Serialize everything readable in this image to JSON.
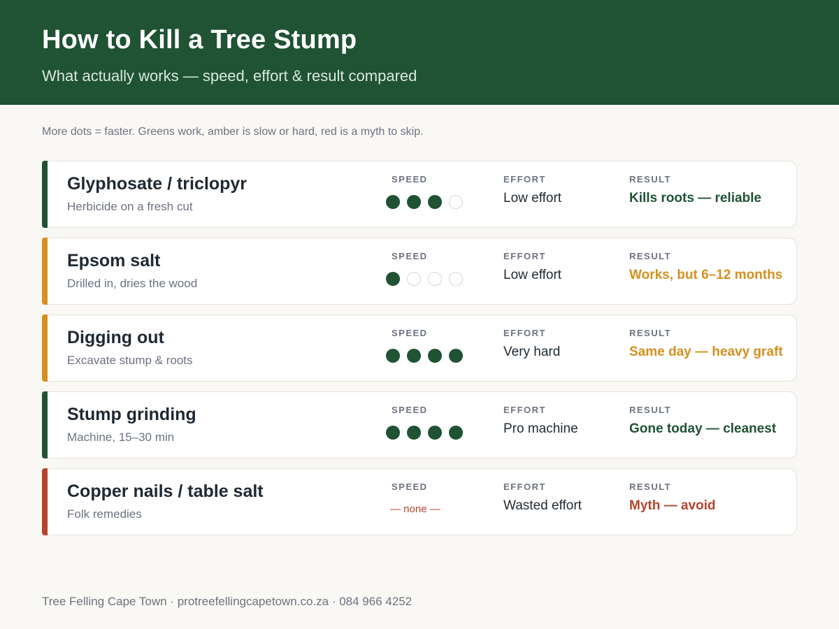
{
  "header": {
    "title": "How to Kill a Tree Stump",
    "subtitle": "What actually works — speed, effort & result compared"
  },
  "legend": "More dots = faster. Greens work, amber is slow or hard, red is a myth to skip.",
  "column_labels": {
    "speed": "SPEED",
    "effort": "EFFORT",
    "result": "RESULT"
  },
  "colors": {
    "green": "#205234",
    "amber": "#d4901f",
    "red": "#b5442c",
    "dot_empty_border": "#d6d6d6"
  },
  "methods": [
    {
      "name": "Glyphosate / triclopyr",
      "description": "Herbicide on a fresh cut",
      "speed_dots": 3,
      "speed_max": 4,
      "speed_text": "",
      "effort": "Low effort",
      "result": "Kills roots — reliable",
      "status": "green"
    },
    {
      "name": "Epsom salt",
      "description": "Drilled in, dries the wood",
      "speed_dots": 1,
      "speed_max": 4,
      "speed_text": "",
      "effort": "Low effort",
      "result": "Works, but 6–12 months",
      "status": "amber"
    },
    {
      "name": "Digging out",
      "description": "Excavate stump & roots",
      "speed_dots": 4,
      "speed_max": 4,
      "speed_text": "",
      "effort": "Very hard",
      "result": "Same day — heavy graft",
      "status": "amber"
    },
    {
      "name": "Stump grinding",
      "description": "Machine, 15–30 min",
      "speed_dots": 4,
      "speed_max": 4,
      "speed_text": "",
      "effort": "Pro machine",
      "result": "Gone today — cleanest",
      "status": "green"
    },
    {
      "name": "Copper nails / table salt",
      "description": "Folk remedies",
      "speed_dots": 0,
      "speed_max": 0,
      "speed_text": "— none —",
      "effort": "Wasted effort",
      "result": "Myth — avoid",
      "status": "red"
    }
  ],
  "footer": "Tree Felling Cape Town · protreefellingcapetown.co.za · 084 966 4252"
}
